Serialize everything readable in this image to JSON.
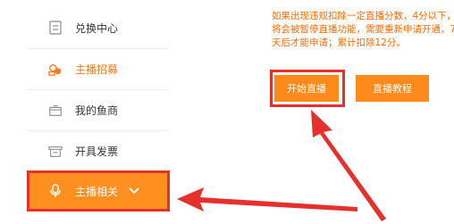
{
  "sidebar": {
    "items": [
      {
        "label": "兑换中心",
        "icon": "document-icon"
      },
      {
        "label": "主播招募",
        "icon": "recruit-icon"
      },
      {
        "label": "我的鱼商",
        "icon": "shop-icon"
      },
      {
        "label": "开具发票",
        "icon": "invoice-icon"
      },
      {
        "label": "主播相关",
        "icon": "microphone-icon"
      }
    ]
  },
  "notice": {
    "text": "如果出现违规扣除一定直播分数，4分以下，将会被暂停直播功能，需要重新申请开通，7天后才能申请；累计扣除12分。"
  },
  "buttons": {
    "start_live": "开始直播",
    "tutorial": "直播教程"
  },
  "colors": {
    "accent": "#ff8a1c",
    "highlight_red": "#e5302b",
    "notice_orange": "#ff6a00",
    "recruit_orange": "#ff7a1f"
  }
}
